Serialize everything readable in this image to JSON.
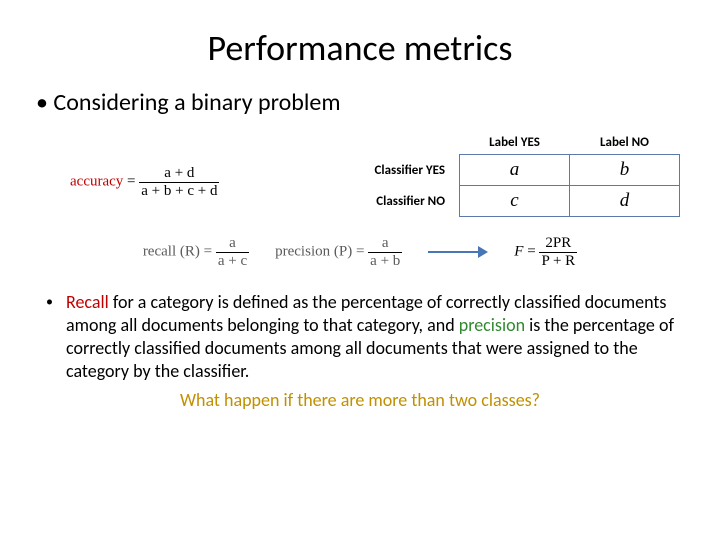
{
  "title": "Performance metrics",
  "intro": "Considering a binary problem",
  "accuracy": {
    "label": "accuracy",
    "numer": "a + d",
    "denom": "a + b + c + d",
    "eq": "="
  },
  "confusion": {
    "col_yes": "Label YES",
    "col_no": "Label NO",
    "row_yes": "Classifier YES",
    "row_no": "Classifier NO",
    "cells": {
      "a": "a",
      "b": "b",
      "c": "c",
      "d": "d"
    }
  },
  "recall": {
    "label": "recall (R)",
    "eq": "=",
    "numer": "a",
    "denom": "a + c"
  },
  "precision": {
    "label": "precision (P)",
    "eq": "=",
    "numer": "a",
    "denom": "a + b"
  },
  "fmeasure": {
    "label": "F",
    "eq": "=",
    "numer": "2PR",
    "denom": "P + R"
  },
  "description": {
    "lead": "Recall",
    "part1": " for a category is defined as the percentage of correctly classified documents among all documents belonging to that category, and ",
    "precision_word": "precision",
    "part2": " is the percentage of correctly classified documents among all documents that were assigned to the category by the classifier."
  },
  "question": "What happen if there are more than two classes?",
  "chart_data": {
    "type": "table",
    "title": "Confusion matrix (binary)",
    "columns": [
      "Label YES",
      "Label NO"
    ],
    "rows": [
      "Classifier YES",
      "Classifier NO"
    ],
    "cells": [
      [
        "a",
        "b"
      ],
      [
        "c",
        "d"
      ]
    ],
    "formulas": {
      "accuracy": "(a + d) / (a + b + c + d)",
      "recall": "a / (a + c)",
      "precision": "a / (a + b)",
      "F": "2PR / (P + R)"
    }
  }
}
